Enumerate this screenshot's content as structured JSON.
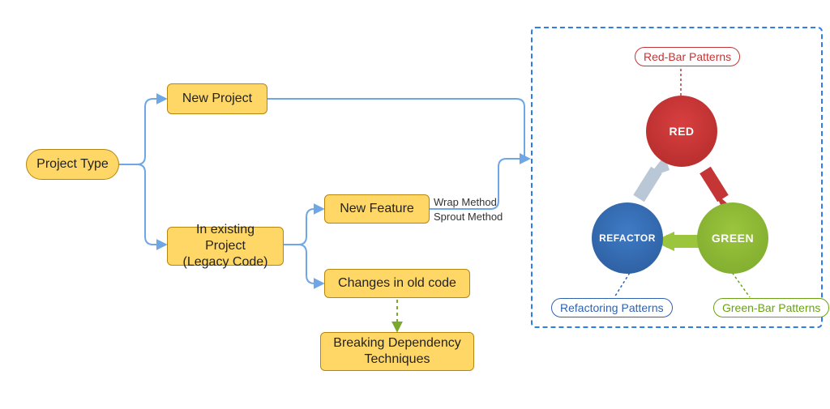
{
  "root": {
    "label": "Project Type"
  },
  "branches": {
    "new_project": {
      "label": "New Project"
    },
    "existing": {
      "label": "In existing Project\n(Legacy Code)",
      "children": {
        "new_feature": {
          "label": "New Feature",
          "annotations": {
            "top": "Wrap Method",
            "bottom": "Sprout Method"
          }
        },
        "old_changes": {
          "label": "Changes in old code",
          "child": {
            "label": "Breaking Dependency\nTechniques"
          }
        }
      }
    }
  },
  "tdd_panel": {
    "circles": {
      "red": "RED",
      "green": "GREEN",
      "refactor": "REFACTOR"
    },
    "patterns": {
      "red": "Red-Bar Patterns",
      "green": "Green-Bar Patterns",
      "refactor": "Refactoring Patterns"
    }
  },
  "colors": {
    "yellow_fill": "#ffd766",
    "yellow_border": "#b8860b",
    "blue_line": "#6fa7e6",
    "green_dash": "#7ca82c",
    "red": "#c43535",
    "green": "#6aa115",
    "blue": "#2f63b0"
  }
}
